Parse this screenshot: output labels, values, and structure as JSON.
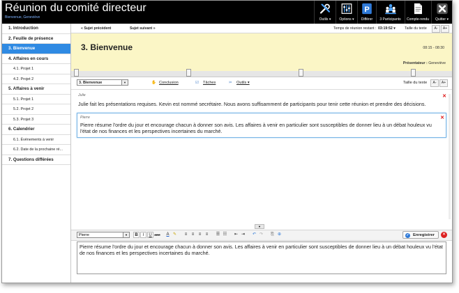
{
  "app": {
    "title": "Réunion du comité directeur",
    "subtitle": "Bienvenue, Geneviève"
  },
  "toolbar": {
    "buttons": [
      {
        "label": "Outils ▾",
        "icon": "tools-icon"
      },
      {
        "label": "Options ▾",
        "icon": "options-icon"
      },
      {
        "label": "Différer",
        "icon": "park-icon"
      },
      {
        "label": "3 Participants",
        "icon": "participants-icon"
      },
      {
        "label": "Compte-rendu",
        "icon": "document-icon"
      },
      {
        "label": "Quitter ▾",
        "icon": "close-icon"
      }
    ]
  },
  "sidebar": {
    "items": [
      {
        "label": "1. Introduction",
        "type": "section"
      },
      {
        "label": "2. Feuille de présence",
        "type": "section"
      },
      {
        "label": "3. Bienvenue",
        "type": "section",
        "active": true
      },
      {
        "label": "4. Affaires en cours",
        "type": "section"
      },
      {
        "label": "4.1. Projet 1",
        "type": "sub"
      },
      {
        "label": "4.2. Projet 2",
        "type": "sub"
      },
      {
        "label": "5. Affaires à venir",
        "type": "section"
      },
      {
        "label": "5.1. Projet 1",
        "type": "sub"
      },
      {
        "label": "5.2. Projet 2",
        "type": "sub"
      },
      {
        "label": "5.3. Projet 3",
        "type": "sub"
      },
      {
        "label": "6. Calendrier",
        "type": "section"
      },
      {
        "label": "6.1. Événements à venir",
        "type": "sub"
      },
      {
        "label": "6.2. Date de la prochaine ré...",
        "type": "sub"
      },
      {
        "label": "7. Questions différées",
        "type": "section"
      }
    ]
  },
  "navbar": {
    "prev_label": "« Sujet précédent",
    "next_label": "Sujet suivant »",
    "remaining_label": "Temps de réunion restant :",
    "remaining_value": "03:19:52 ▾",
    "text_size_label": "Taille du texte",
    "font_smaller": "A-",
    "font_larger": "A+"
  },
  "topic": {
    "title": "3. Bienvenue",
    "time_range": "08:15 - 08:30",
    "presenter_label": "Présentateur :",
    "presenter_name": "Geneviève"
  },
  "subbar": {
    "selected_topic": "3. Bienvenue",
    "conclusion_label": "Conclusion",
    "tasks_label": "Tâches",
    "tools_label": "Outils ▾",
    "text_size_label": "Taille du texte",
    "font_smaller": "A-",
    "font_larger": "A+"
  },
  "notes": [
    {
      "author": "Julie",
      "text": "Julie fait les présentations requises. Kevin est nommé secrétaire. Nous avons suffisamment de participants pour tenir cette réunion et prendre des décisions."
    },
    {
      "author": "Pierre",
      "text": "Pierre résume l'ordre du jour et encourage chacun à donner son avis. Les affaires à venir en particulier sont susceptibles de donner lieu à un débat houleux vu l'état de nos finances et les perspectives incertaines du marché."
    }
  ],
  "editor": {
    "author_select": "Pierre",
    "save_label": "Enregistrer",
    "content": "Pierre résume l'ordre du jour et encourage chacun à donner son avis. Les affaires à venir en particulier sont susceptibles de donner lieu à un débat houleux vu l'état de nos finances et les perspectives incertaines du marché."
  },
  "colors": {
    "accent": "#2f8ae3",
    "header_bg": "#fbf6c6",
    "topbar_bg": "#000000",
    "delete": "#dd1111"
  }
}
